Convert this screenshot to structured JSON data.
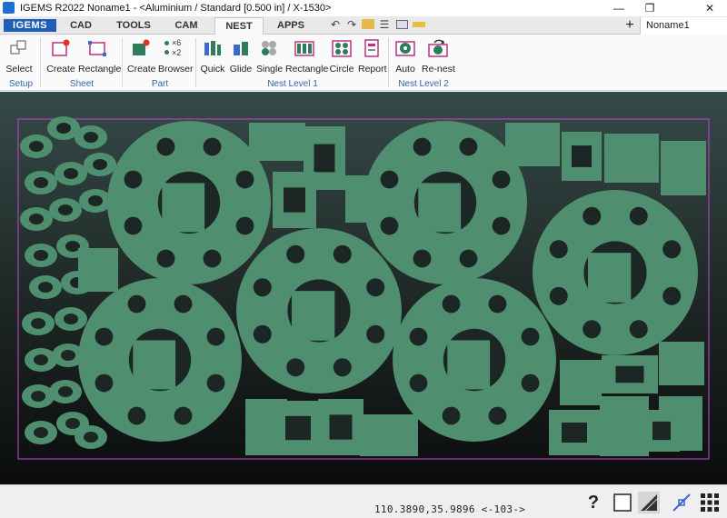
{
  "window": {
    "title": "IGEMS R2022  Noname1 - <Aluminium / Standard [0.500 in] / X-1530>",
    "controls": [
      "—",
      "❐",
      "✕"
    ]
  },
  "logo": "IGEMS",
  "tabs": [
    "CAD",
    "TOOLS",
    "CAM",
    "NEST",
    "APPS"
  ],
  "active_tab": "NEST",
  "document_tab": "Noname1",
  "ribbon": {
    "buttons": [
      "Select",
      "Create",
      "Rectangle",
      "Create",
      "Browser",
      "Quick",
      "Glide",
      "Single",
      "Rectangle",
      "Circle",
      "Report",
      "Auto",
      "Re-nest"
    ],
    "groups": [
      "Setup",
      "Sheet",
      "Part",
      "Nest Level 1",
      "Nest Level 2"
    ],
    "browser_counts": [
      "×6",
      "×2"
    ]
  },
  "status": {
    "coordinates": "110.3890,35.9896 <-103->",
    "help": "?"
  },
  "colors": {
    "part_fill": "#4f8f6f",
    "sheet_border": "#b040c0",
    "accent_blue": "#1f5fb8"
  }
}
